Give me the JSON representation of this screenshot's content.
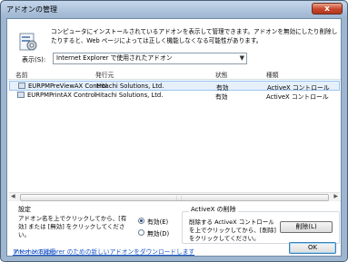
{
  "window": {
    "title": "アドオンの管理",
    "close_glyph": "x"
  },
  "intro": {
    "text": "コンピュータにインストールされているアドオンを表示して管理できます。アドオンを無効にしたり削除したりすると、Web ページによっては正しく機能しなくなる可能性があります。"
  },
  "filter": {
    "label": "表示(S):",
    "selected": "Internet Explorer で使用されたアドオン"
  },
  "columns": {
    "name": "名前",
    "publisher": "発行元",
    "status": "状態",
    "type": "種類"
  },
  "rows": [
    {
      "name": "EURPMPreViewAX Control",
      "publisher": "Hitachi Solutions, Ltd.",
      "status": "有効",
      "type": "ActiveX コントロール",
      "selected": true
    },
    {
      "name": "EURPMPrintAX Control",
      "publisher": "Hitachi Solutions, Ltd.",
      "status": "有効",
      "type": "ActiveX コントロール",
      "selected": false
    }
  ],
  "settings": {
    "title": "設定",
    "text": "アドオン名を上でクリックしてから、[有効] または [無効] をクリックしてください。",
    "enable_label": "有効(E)",
    "disable_label": "無効(D)",
    "enabled_selected": true
  },
  "activex_delete": {
    "title": "ActiveX の削除",
    "text": "削除する ActiveX コントロールを上でクリックしてから、[削除] をクリックしてください。",
    "button": "削除(L)"
  },
  "links": {
    "download": "Internet Explorer のための新しいアドオンをダウンロードします",
    "details": "アドオンの詳細"
  },
  "ok_button": "OK",
  "colors": {
    "link": "#1a55c6",
    "selection": "#e6f0fb",
    "title_bar": "#b3c8e0"
  }
}
